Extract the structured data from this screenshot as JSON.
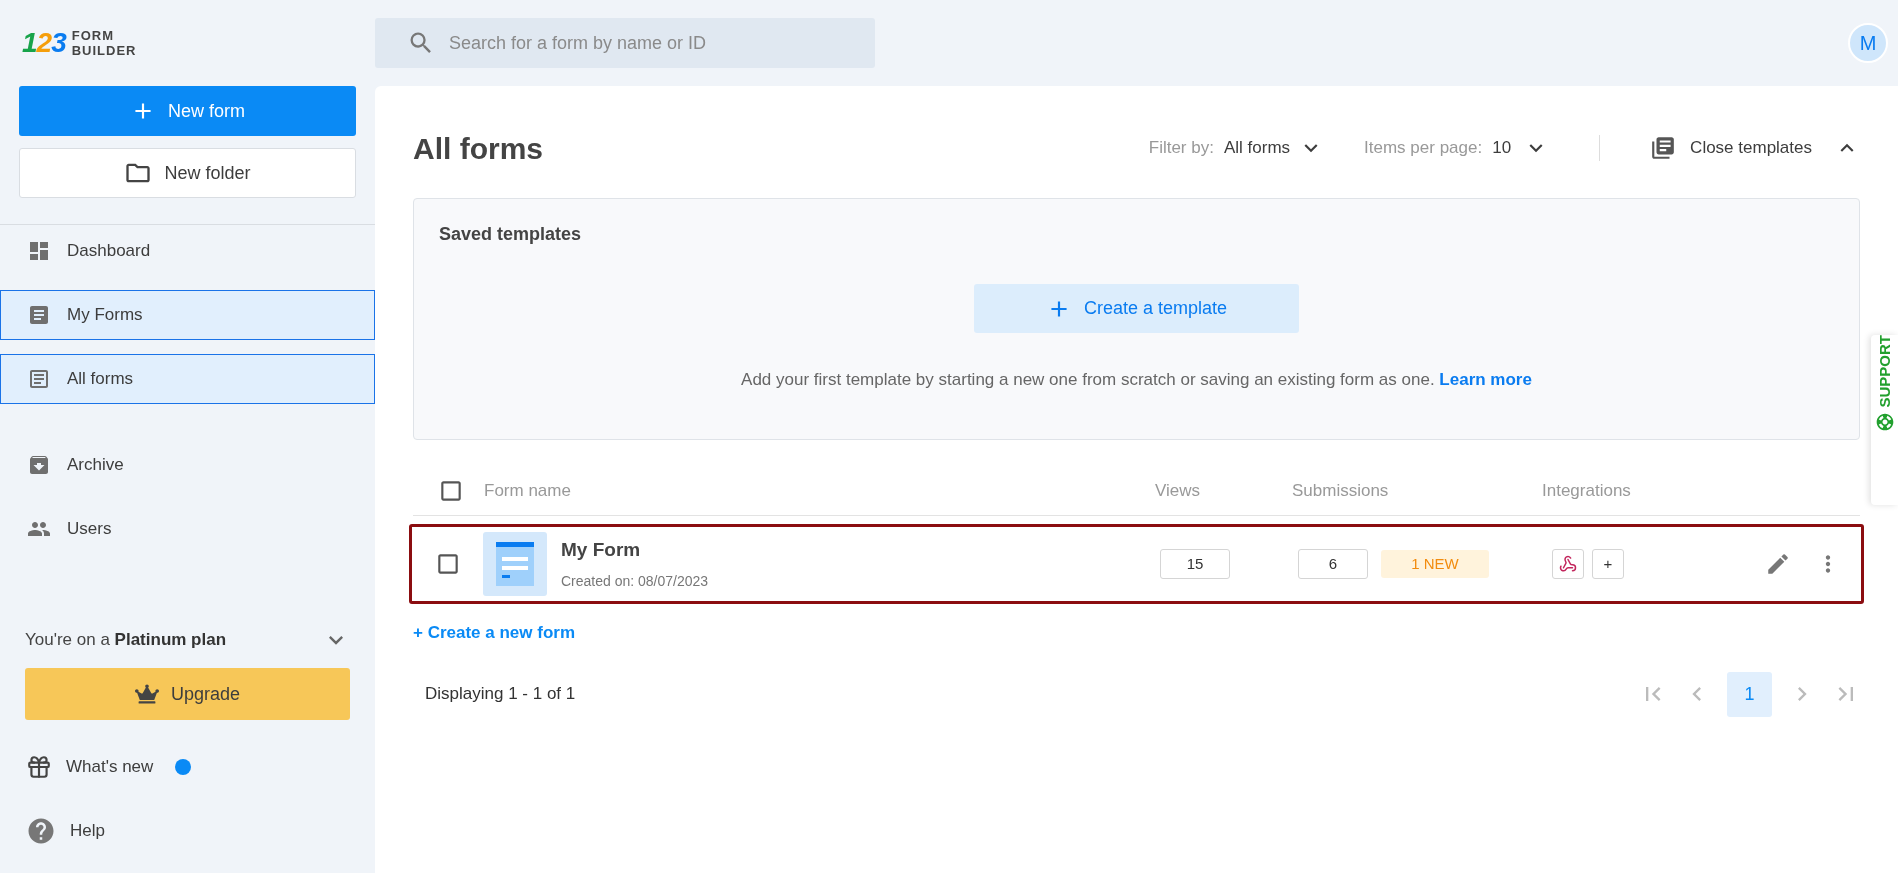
{
  "logo": {
    "mark": "123",
    "words": [
      "FORM",
      "BUILDER"
    ]
  },
  "search": {
    "placeholder": "Search for a form by name or ID"
  },
  "avatar": {
    "initial": "M"
  },
  "sidebar": {
    "new_form": "New form",
    "new_folder": "New folder",
    "nav": [
      {
        "label": "Dashboard",
        "selected": false
      },
      {
        "label": "My Forms",
        "selected": true,
        "children": [
          {
            "label": "All forms",
            "selected": true
          }
        ]
      }
    ],
    "nav_2": [
      {
        "label": "Archive",
        "selected": false
      },
      {
        "label": "Users",
        "selected": false
      }
    ],
    "plan": {
      "prefix": "You're on a",
      "name": "Platinum plan"
    },
    "upgrade": "Upgrade",
    "whats_new": {
      "label": "What's new",
      "unread": true
    },
    "help": "Help"
  },
  "main": {
    "title": "All forms",
    "filter": {
      "label": "Filter by:",
      "value": "All forms"
    },
    "per_page": {
      "label": "Items per page:",
      "value": "10"
    },
    "close_templates": "Close templates",
    "templates": {
      "title": "Saved templates",
      "create": "Create a template",
      "text": "Add your first template by starting a new one from scratch or saving an existing form as one.",
      "link": "Learn more"
    },
    "table": {
      "select_all": {
        "checked": false
      },
      "columns": [
        "Form name",
        "Views",
        "Submissions",
        "Integrations"
      ],
      "rows": [
        {
          "checked": false,
          "highlighted": true,
          "name": "My Form",
          "created": "Created on: 08/07/2023",
          "views": "15",
          "submissions": "6",
          "badge": "1 NEW",
          "add": "+"
        }
      ]
    },
    "create_new": "+ Create a new form",
    "footer": "Displaying 1 - 1 of 1",
    "pages": [
      {
        "label": "1",
        "selected": true
      }
    ]
  },
  "support": "SUPPORT"
}
